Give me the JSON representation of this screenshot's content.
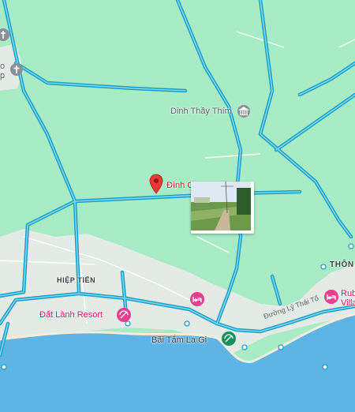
{
  "labels": {
    "dinh_thay_thim": "Dinh Thầy Thím",
    "dinh_partial": "Đình C",
    "hiep_tien": "HIỆP TIẾN",
    "dat_lanh_resort": "Đất Lành Resort",
    "bai_tam": "Bãi Tắm La Gi",
    "thon": "THÔN",
    "duong_ly_thai_to": "Đường Lý Thái Tổ",
    "rub": "Rub",
    "villa": "Villa",
    "edge_o": "o",
    "edge_p": "p"
  },
  "icons": {
    "museum": "museum-icon",
    "church": "church-icon",
    "pin": "red-pin-icon",
    "hotel": "hotel-icon",
    "beach": "beach-icon"
  },
  "colors": {
    "land": "#a8ecc6",
    "urban": "#e6ece9",
    "water": "#5fb4e6",
    "route": "#1d9fc7",
    "route_core": "#7ad7ef",
    "pin": "#e53935",
    "hotel": "#e8408f",
    "beach_badge": "#17905f"
  }
}
